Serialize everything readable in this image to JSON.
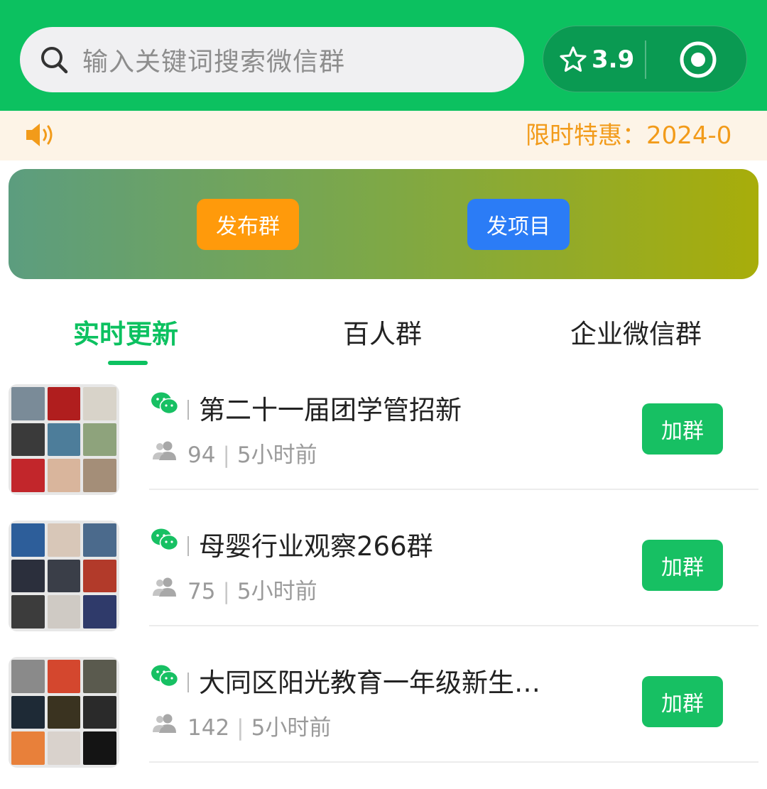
{
  "header": {
    "search_placeholder": "输入关键词搜索微信群",
    "rating": "3.9",
    "brand_color": "#0cc160"
  },
  "notice": {
    "text": "限时特惠：2024-0"
  },
  "banner": {
    "publish_label": "发布群",
    "project_label": "发项目"
  },
  "tabs": [
    {
      "label": "实时更新",
      "active": true
    },
    {
      "label": "百人群",
      "active": false
    },
    {
      "label": "企业微信群",
      "active": false
    }
  ],
  "groups": [
    {
      "name": "第二十一届团学管招新",
      "members": "94",
      "time": "5小时前",
      "join_label": "加群"
    },
    {
      "name": "母婴行业观察266群",
      "members": "75",
      "time": "5小时前",
      "join_label": "加群"
    },
    {
      "name": "大同区阳光教育一年级新生…",
      "members": "142",
      "time": "5小时前",
      "join_label": "加群"
    }
  ],
  "icons": {
    "search": "search-icon",
    "star": "star-icon",
    "target": "target-icon",
    "speaker": "speaker-icon",
    "wechat": "wechat-icon",
    "people": "people-icon"
  }
}
